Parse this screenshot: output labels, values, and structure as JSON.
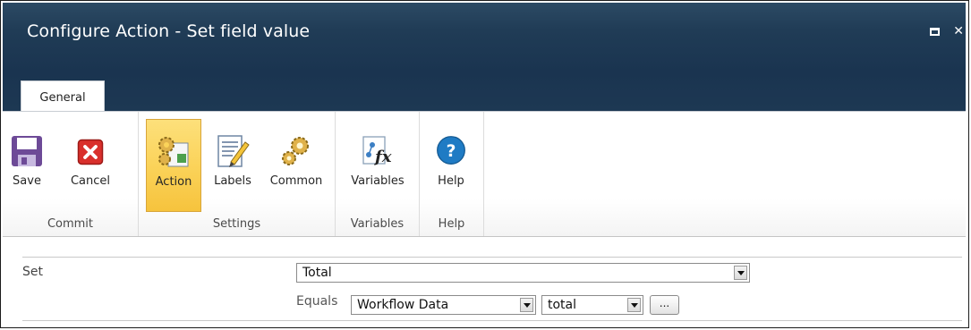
{
  "window": {
    "title": "Configure Action - Set field value",
    "maximize_icon": "maximize-icon",
    "close_glyph": "✕"
  },
  "tabs": [
    {
      "label": "General"
    }
  ],
  "ribbon": {
    "groups": [
      {
        "label": "Commit",
        "buttons": [
          {
            "label": "Save",
            "icon": "save-icon"
          },
          {
            "label": "Cancel",
            "icon": "cancel-icon"
          }
        ]
      },
      {
        "label": "Settings",
        "buttons": [
          {
            "label": "Action",
            "icon": "action-gears-icon",
            "selected": true
          },
          {
            "label": "Labels",
            "icon": "labels-icon"
          },
          {
            "label": "Common",
            "icon": "common-gears-icon"
          }
        ]
      },
      {
        "label": "Variables",
        "buttons": [
          {
            "label": "Variables",
            "icon": "variables-fx-icon"
          }
        ]
      },
      {
        "label": "Help",
        "buttons": [
          {
            "label": "Help",
            "icon": "help-icon"
          }
        ]
      }
    ]
  },
  "form": {
    "set_label": "Set",
    "set_value": "Total",
    "equals_label": "Equals",
    "source_value": "Workflow Data",
    "field_value": "total",
    "ellipsis_label": "..."
  },
  "colors": {
    "title_bar": "#203c56",
    "selected_button": "#fbd35a",
    "cancel_red": "#d9302c",
    "help_blue": "#1f7bc4"
  }
}
